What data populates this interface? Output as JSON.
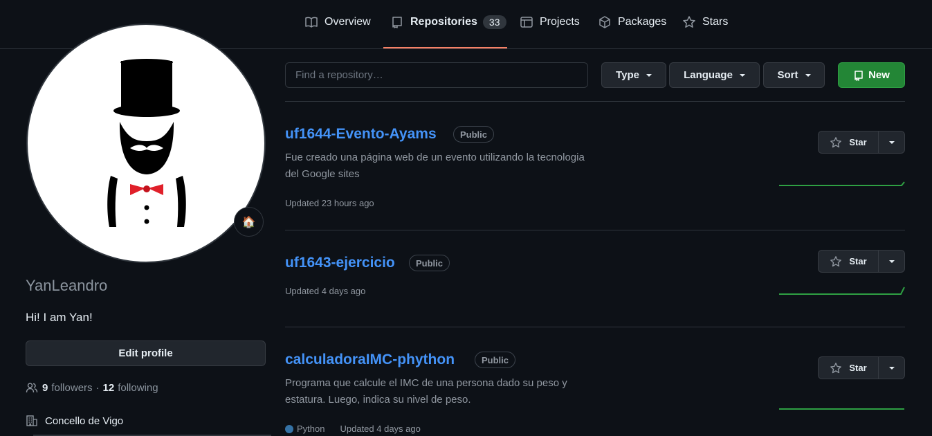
{
  "nav": {
    "tabs": [
      {
        "label": "Overview",
        "icon": "book-icon"
      },
      {
        "label": "Repositories",
        "icon": "repo-icon",
        "count": "33"
      },
      {
        "label": "Projects",
        "icon": "table-icon"
      },
      {
        "label": "Packages",
        "icon": "package-icon"
      },
      {
        "label": "Stars",
        "icon": "star-icon"
      }
    ]
  },
  "profile": {
    "status_emoji": "🏠",
    "username": "YanLeandro",
    "bio": "Hi! I am Yan!",
    "edit_label": "Edit profile",
    "followers_count": "9",
    "followers_label": "followers",
    "separator": "·",
    "following_count": "12",
    "following_label": "following",
    "organization": "Concello de Vigo"
  },
  "filters": {
    "search_placeholder": "Find a repository…",
    "type_label": "Type",
    "language_label": "Language",
    "sort_label": "Sort",
    "new_label": "New"
  },
  "repos": [
    {
      "name": "uf1644-Evento-Ayams",
      "visibility": "Public",
      "description": [
        "Fue creado una página web de un evento utilizando la tecnologia",
        "del Google sites"
      ],
      "language": "",
      "updated": "Updated 23 hours ago",
      "star_label": "Star"
    },
    {
      "name": "uf1643-ejercicio",
      "visibility": "Public",
      "description": [],
      "language": "",
      "updated": "Updated 4 days ago",
      "star_label": "Star"
    },
    {
      "name": "calculadoraIMC-phython",
      "visibility": "Public",
      "description": [
        "Programa que calcule el IMC de una persona dado su peso y",
        "estatura. Luego, indica su nivel de peso."
      ],
      "language": "Python",
      "updated": "Updated 4 days ago",
      "star_label": "Star"
    }
  ],
  "colors": {
    "accent_link": "#4493f8",
    "tab_underline": "#f78166",
    "new_button": "#238636",
    "python": "#3572A5",
    "sparkline": "#2ea043"
  }
}
